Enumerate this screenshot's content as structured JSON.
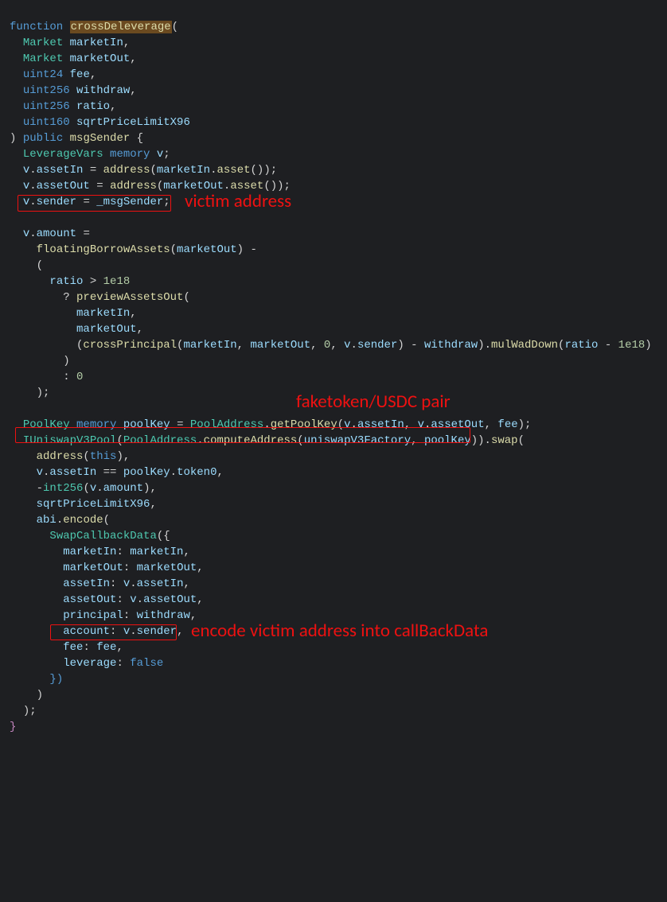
{
  "code": {
    "l1a": "function",
    "l1b": "crossDeleverage",
    "l1c": "(",
    "l2a": "Market",
    "l2b": "marketIn",
    "l2c": ",",
    "l3a": "Market",
    "l3b": "marketOut",
    "l3c": ",",
    "l4a": "uint24",
    "l4b": "fee",
    "l4c": ",",
    "l5a": "uint256",
    "l5b": "withdraw",
    "l5c": ",",
    "l6a": "uint256",
    "l6b": "ratio",
    "l6c": ",",
    "l7a": "uint160",
    "l7b": "sqrtPriceLimitX96",
    "l8a": ")",
    "l8b": "public",
    "l8c": "msgSender",
    "l8d": "{",
    "l9a": "LeverageVars",
    "l9b": "memory",
    "l9c": "v",
    "l9d": ";",
    "l10a": "v",
    "l10b": ".",
    "l10c": "assetIn",
    "l10d": " = ",
    "l10e": "address",
    "l10f": "(",
    "l10g": "marketIn",
    "l10h": ".",
    "l10i": "asset",
    "l10j": "());",
    "l11a": "v",
    "l11b": ".",
    "l11c": "assetOut",
    "l11d": " = ",
    "l11e": "address",
    "l11f": "(",
    "l11g": "marketOut",
    "l11h": ".",
    "l11i": "asset",
    "l11j": "());",
    "l12a": "v",
    "l12b": ".",
    "l12c": "sender",
    "l12d": " = ",
    "l12e": "_msgSender",
    "l12f": ";",
    "l14a": "v",
    "l14b": ".",
    "l14c": "amount",
    "l14d": " =",
    "l15a": "floatingBorrowAssets",
    "l15b": "(",
    "l15c": "marketOut",
    "l15d": ") -",
    "l16a": "(",
    "l17a": "ratio",
    "l17b": " > ",
    "l17c": "1e18",
    "l18a": "? ",
    "l18b": "previewAssetsOut",
    "l18c": "(",
    "l19a": "marketIn",
    "l19b": ",",
    "l20a": "marketOut",
    "l20b": ",",
    "l21a": "(",
    "l21b": "crossPrincipal",
    "l21c": "(",
    "l21d": "marketIn",
    "l21e": ", ",
    "l21f": "marketOut",
    "l21g": ", ",
    "l21h": "0",
    "l21i": ", ",
    "l21j": "v",
    "l21k": ".",
    "l21l": "sender",
    "l21m": ") - ",
    "l21n": "withdraw",
    "l21o": ").",
    "l21p": "mulWadDown",
    "l21q": "(",
    "l21r": "ratio",
    "l21s": " - ",
    "l21t": "1e18",
    "l21u": ")",
    "l22a": ")",
    "l23a": ": ",
    "l23b": "0",
    "l24a": ");",
    "l26a": "PoolKey",
    "l26b": "memory",
    "l26c": "poolKey",
    "l26d": " = ",
    "l26e": "PoolAddress",
    "l26f": ".",
    "l26g": "getPoolKey",
    "l26h": "(",
    "l26i": "v",
    "l26j": ".",
    "l26k": "assetIn",
    "l26l": ", ",
    "l26m": "v",
    "l26n": ".",
    "l26o": "assetOut",
    "l26p": ", ",
    "l26q": "fee",
    "l26r": ");",
    "l27a": "IUniswapV3Pool",
    "l27b": "(",
    "l27c": "PoolAddress",
    "l27d": ".",
    "l27e": "computeAddress",
    "l27f": "(",
    "l27g": "uniswapV3Factory",
    "l27h": ", ",
    "l27i": "poolKey",
    "l27j": ")).",
    "l27k": "swap",
    "l27l": "(",
    "l28a": "address",
    "l28b": "(",
    "l28c": "this",
    "l28d": "),",
    "l29a": "v",
    "l29b": ".",
    "l29c": "assetIn",
    "l29d": " == ",
    "l29e": "poolKey",
    "l29f": ".",
    "l29g": "token0",
    "l29h": ",",
    "l30a": "-",
    "l30b": "int256",
    "l30c": "(",
    "l30d": "v",
    "l30e": ".",
    "l30f": "amount",
    "l30g": "),",
    "l31a": "sqrtPriceLimitX96",
    "l31b": ",",
    "l32a": "abi",
    "l32b": ".",
    "l32c": "encode",
    "l32d": "(",
    "l33a": "SwapCallbackData",
    "l33b": "({",
    "l34a": "marketIn",
    "l34b": ": ",
    "l34c": "marketIn",
    "l34d": ",",
    "l35a": "marketOut",
    "l35b": ": ",
    "l35c": "marketOut",
    "l35d": ",",
    "l36a": "assetIn",
    "l36b": ": ",
    "l36c": "v",
    "l36d": ".",
    "l36e": "assetIn",
    "l36f": ",",
    "l37a": "assetOut",
    "l37b": ": ",
    "l37c": "v",
    "l37d": ".",
    "l37e": "assetOut",
    "l37f": ",",
    "l38a": "principal",
    "l38b": ": ",
    "l38c": "withdraw",
    "l38d": ",",
    "l39a": "account",
    "l39b": ": ",
    "l39c": "v",
    "l39d": ".",
    "l39e": "sender",
    "l39f": ",",
    "l40a": "fee",
    "l40b": ": ",
    "l40c": "fee",
    "l40d": ",",
    "l41a": "leverage",
    "l41b": ": ",
    "l41c": "false",
    "l42a": "})",
    "l43a": ")",
    "l44a": ");",
    "l45a": "}"
  },
  "annotations": {
    "a1": "victim address",
    "a2": "faketoken/USDC pair",
    "a3": "encode victim address into callBackData"
  }
}
